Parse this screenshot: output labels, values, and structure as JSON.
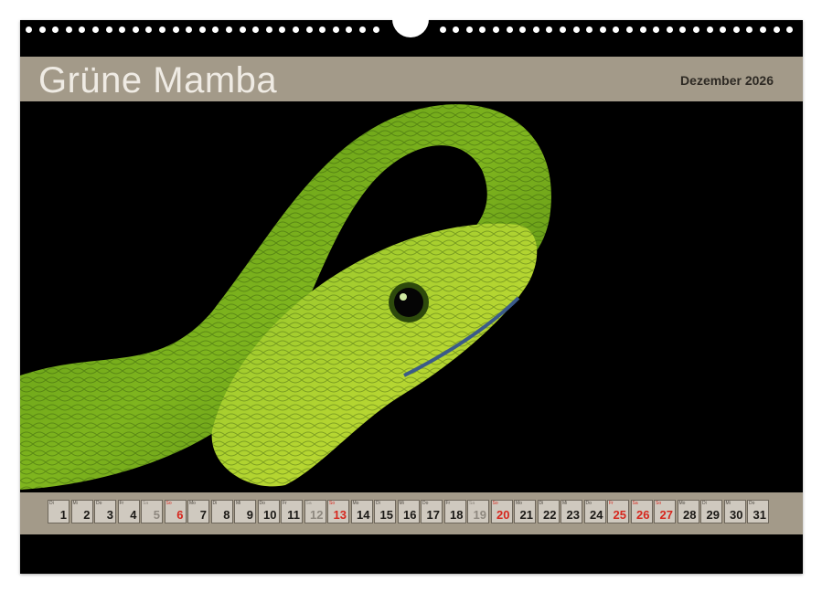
{
  "calendar": {
    "title": "Grüne Mamba",
    "month_label": "Dezember 2026"
  },
  "days": [
    {
      "wd": "Di",
      "num": "1",
      "type": "weekday"
    },
    {
      "wd": "Mi",
      "num": "2",
      "type": "weekday"
    },
    {
      "wd": "Do",
      "num": "3",
      "type": "weekday"
    },
    {
      "wd": "Fr",
      "num": "4",
      "type": "weekday"
    },
    {
      "wd": "Sa",
      "num": "5",
      "type": "sat"
    },
    {
      "wd": "So",
      "num": "6",
      "type": "sun"
    },
    {
      "wd": "Mo",
      "num": "7",
      "type": "weekday"
    },
    {
      "wd": "Di",
      "num": "8",
      "type": "weekday"
    },
    {
      "wd": "Mi",
      "num": "9",
      "type": "weekday"
    },
    {
      "wd": "Do",
      "num": "10",
      "type": "weekday"
    },
    {
      "wd": "Fr",
      "num": "11",
      "type": "weekday"
    },
    {
      "wd": "Sa",
      "num": "12",
      "type": "sat"
    },
    {
      "wd": "So",
      "num": "13",
      "type": "sun"
    },
    {
      "wd": "Mo",
      "num": "14",
      "type": "weekday"
    },
    {
      "wd": "Di",
      "num": "15",
      "type": "weekday"
    },
    {
      "wd": "Mi",
      "num": "16",
      "type": "weekday"
    },
    {
      "wd": "Do",
      "num": "17",
      "type": "weekday"
    },
    {
      "wd": "Fr",
      "num": "18",
      "type": "weekday"
    },
    {
      "wd": "Sa",
      "num": "19",
      "type": "sat"
    },
    {
      "wd": "So",
      "num": "20",
      "type": "sun"
    },
    {
      "wd": "Mo",
      "num": "21",
      "type": "weekday"
    },
    {
      "wd": "Di",
      "num": "22",
      "type": "weekday"
    },
    {
      "wd": "Mi",
      "num": "23",
      "type": "weekday"
    },
    {
      "wd": "Do",
      "num": "24",
      "type": "weekday"
    },
    {
      "wd": "Fr",
      "num": "25",
      "type": "hol"
    },
    {
      "wd": "Sa",
      "num": "26",
      "type": "hol"
    },
    {
      "wd": "So",
      "num": "27",
      "type": "sun"
    },
    {
      "wd": "Mo",
      "num": "28",
      "type": "weekday"
    },
    {
      "wd": "Di",
      "num": "29",
      "type": "weekday"
    },
    {
      "wd": "Mi",
      "num": "30",
      "type": "weekday"
    },
    {
      "wd": "Do",
      "num": "31",
      "type": "weekday"
    }
  ],
  "colors": {
    "band": "#a39a89",
    "holiday": "#d6271e",
    "background": "#000000"
  }
}
